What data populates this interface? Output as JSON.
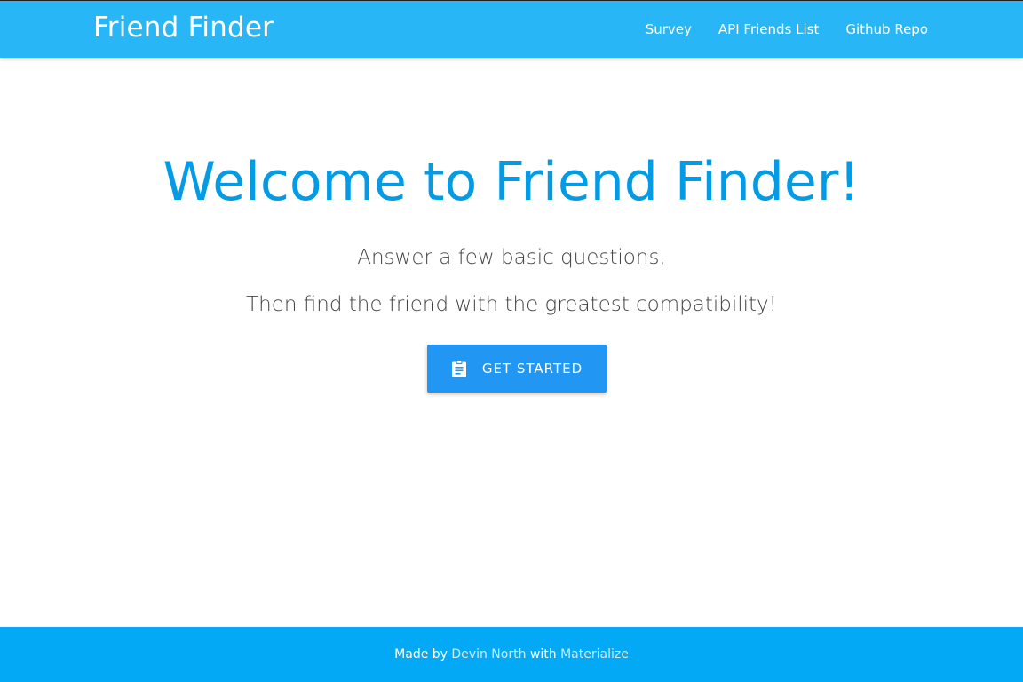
{
  "navbar": {
    "brand": "Friend Finder",
    "links": [
      {
        "label": "Survey"
      },
      {
        "label": "API Friends List"
      },
      {
        "label": "Github Repo"
      }
    ],
    "color": "#29b6f6"
  },
  "hero": {
    "title": "Welcome to Friend Finder!",
    "line1": "Answer a few basic questions,",
    "line2": "Then find the friend with the greatest compatibility!",
    "button": {
      "label": "GET STARTED",
      "icon": "clipboard-icon",
      "color": "#2196f3"
    },
    "title_color": "#039be5"
  },
  "footer": {
    "prefix": "Made by ",
    "author": "Devin North",
    "middle": " with ",
    "framework": "Materialize",
    "color": "#03a9f4"
  }
}
